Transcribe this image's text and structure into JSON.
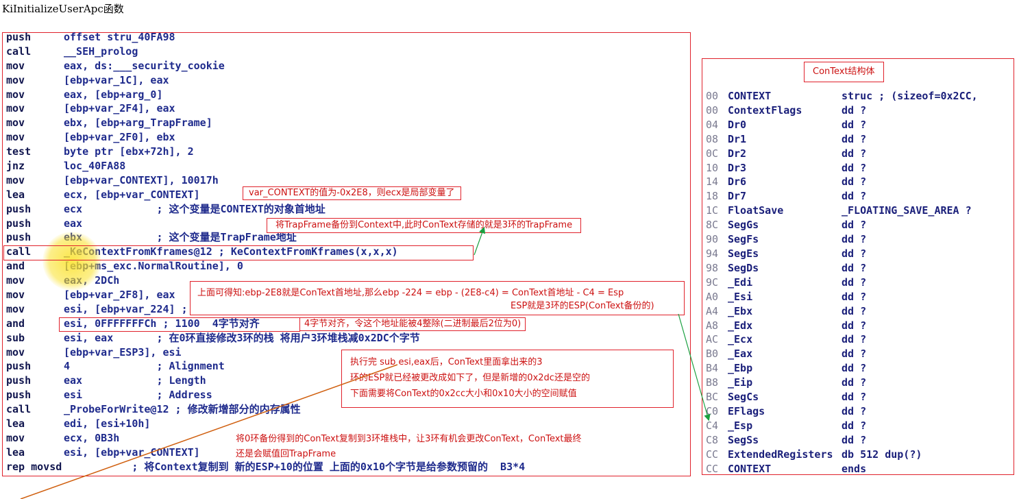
{
  "title": "KiInitializeUserApc函数",
  "asm_lines": [
    {
      "op": "push",
      "args": "offset stru_40FA98"
    },
    {
      "op": "call",
      "args": "__SEH_prolog"
    },
    {
      "op": "mov",
      "args": "eax, ds:___security_cookie"
    },
    {
      "op": "mov",
      "args": "[ebp+var_1C], eax"
    },
    {
      "op": "mov",
      "args": "eax, [ebp+arg_0]"
    },
    {
      "op": "mov",
      "args": "[ebp+var_2F4], eax"
    },
    {
      "op": "mov",
      "args": "ebx, [ebp+arg_TrapFrame]"
    },
    {
      "op": "mov",
      "args": "[ebp+var_2F0], ebx"
    },
    {
      "op": "test",
      "args": "byte ptr [ebx+72h], 2"
    },
    {
      "op": "jnz",
      "args": "loc_40FA88"
    },
    {
      "op": "mov",
      "args": "[ebp+var_CONTEXT], 10017h"
    },
    {
      "op": "lea",
      "args": "ecx, [ebp+var_CONTEXT]"
    },
    {
      "op": "push",
      "args": "ecx            ; 这个变量是CONTEXT的对象首地址"
    },
    {
      "op": "push",
      "args": "eax"
    },
    {
      "op": "push",
      "args": "ebx            ; 这个变量是TrapFrame地址"
    },
    {
      "op": "call",
      "args": "_KeContextFromKframes@12 ; KeContextFromKframes(x,x,x)"
    },
    {
      "op": "and",
      "args": "[ebp+ms_exc.NormalRoutine], 0"
    },
    {
      "op": "mov",
      "args": "eax, 2DCh"
    },
    {
      "op": "mov",
      "args": "[ebp+var_2F8], eax"
    },
    {
      "op": "mov",
      "args": "esi, [ebp+var_224] ; 2E8 - 224 = C4 刚好是CONTEXT结构ESP的偏移"
    },
    {
      "op": "and",
      "args": "esi, 0FFFFFFFCh ; 1100  4字节对齐"
    },
    {
      "op": "sub",
      "args": "esi, eax       ; 在0环直接修改3环的栈 将用户3环堆栈减0x2DC个字节"
    },
    {
      "op": "mov",
      "args": "[ebp+var_ESP3], esi"
    },
    {
      "op": "push",
      "args": "4              ; Alignment"
    },
    {
      "op": "push",
      "args": "eax            ; Length"
    },
    {
      "op": "push",
      "args": "esi            ; Address"
    },
    {
      "op": "call",
      "args": "_ProbeForWrite@12 ; 修改新增部分的内存属性"
    },
    {
      "op": "lea",
      "args": "edi, [esi+10h]"
    },
    {
      "op": "mov",
      "args": "ecx, 0B3h"
    },
    {
      "op": "lea",
      "args": "esi, [ebp+var_CONTEXT]"
    },
    {
      "op": "rep movsd",
      "args": "           ; 将Context复制到 新的ESP+10的位置 上面的0x10个字节是给参数预留的  B3*4"
    }
  ],
  "struct_title": "ConText结构体",
  "struct_rows": [
    {
      "off": "00",
      "name": "CONTEXT",
      "type": "struc ; (sizeof=0x2CC,"
    },
    {
      "off": "00",
      "name": "ContextFlags",
      "type": "dd ?"
    },
    {
      "off": "04",
      "name": "Dr0",
      "type": "dd ?"
    },
    {
      "off": "08",
      "name": "Dr1",
      "type": "dd ?"
    },
    {
      "off": "0C",
      "name": "Dr2",
      "type": "dd ?"
    },
    {
      "off": "10",
      "name": "Dr3",
      "type": "dd ?"
    },
    {
      "off": "14",
      "name": "Dr6",
      "type": "dd ?"
    },
    {
      "off": "18",
      "name": "Dr7",
      "type": "dd ?"
    },
    {
      "off": "1C",
      "name": "FloatSave",
      "type": "_FLOATING_SAVE_AREA ?"
    },
    {
      "off": "8C",
      "name": "SegGs",
      "type": "dd ?"
    },
    {
      "off": "90",
      "name": "SegFs",
      "type": "dd ?"
    },
    {
      "off": "94",
      "name": "SegEs",
      "type": "dd ?"
    },
    {
      "off": "98",
      "name": "SegDs",
      "type": "dd ?"
    },
    {
      "off": "9C",
      "name": "_Edi",
      "type": "dd ?"
    },
    {
      "off": "A0",
      "name": "_Esi",
      "type": "dd ?"
    },
    {
      "off": "A4",
      "name": "_Ebx",
      "type": "dd ?"
    },
    {
      "off": "A8",
      "name": "_Edx",
      "type": "dd ?"
    },
    {
      "off": "AC",
      "name": "_Ecx",
      "type": "dd ?"
    },
    {
      "off": "B0",
      "name": "_Eax",
      "type": "dd ?"
    },
    {
      "off": "B4",
      "name": "_Ebp",
      "type": "dd ?"
    },
    {
      "off": "B8",
      "name": "_Eip",
      "type": "dd ?"
    },
    {
      "off": "BC",
      "name": "SegCs",
      "type": "dd ?"
    },
    {
      "off": "C0",
      "name": "EFlags",
      "type": "dd ?"
    },
    {
      "off": "C4",
      "name": "_Esp",
      "type": "dd ?"
    },
    {
      "off": "C8",
      "name": "SegSs",
      "type": "dd ?"
    },
    {
      "off": "CC",
      "name": "ExtendedRegisters",
      "type": "db 512 dup(?)"
    },
    {
      "off": "CC",
      "name": "CONTEXT",
      "type": "ends"
    }
  ],
  "notes": {
    "var_context": "var_CONTEXT的值为-0x2E8，则ecx是局部变量了",
    "trapframe_backup": "将TrapFrame备份到Context中,此时ConText存储的就是3环的TrapFrame",
    "esp_calc": "上面可得知:ebp-2E8就是ConText首地址,那么ebp -224 = ebp - (2E8-c4) = ConText首地址 - C4 = Esp",
    "esp_ring3": "ESP就是3环的ESP(ConText备份的)",
    "align": "4字节对齐，令这个地址能被4整除(二进制最后2位为0)",
    "after_sub_1": "执行完 sub esi,eax后，ConText里面拿出来的3",
    "after_sub_2": "环的ESP就已经被更改成如下了，但是新增的0x2dc还是空的",
    "after_sub_3": "下面需要将ConText的0x2cc大小和0x10大小的空间赋值",
    "copy_1": "将0环备份得到的ConText复制到3环堆栈中，让3环有机会更改ConText，ConText最终",
    "copy_2": "还是会赋值回TrapFrame"
  },
  "colors": {
    "box": "#e0202a",
    "note": "#cc1010",
    "code": "#1a1f7a",
    "arrow_green": "#1aa040",
    "arrow_orange": "#d06010",
    "highlight": "#f3e24a"
  }
}
